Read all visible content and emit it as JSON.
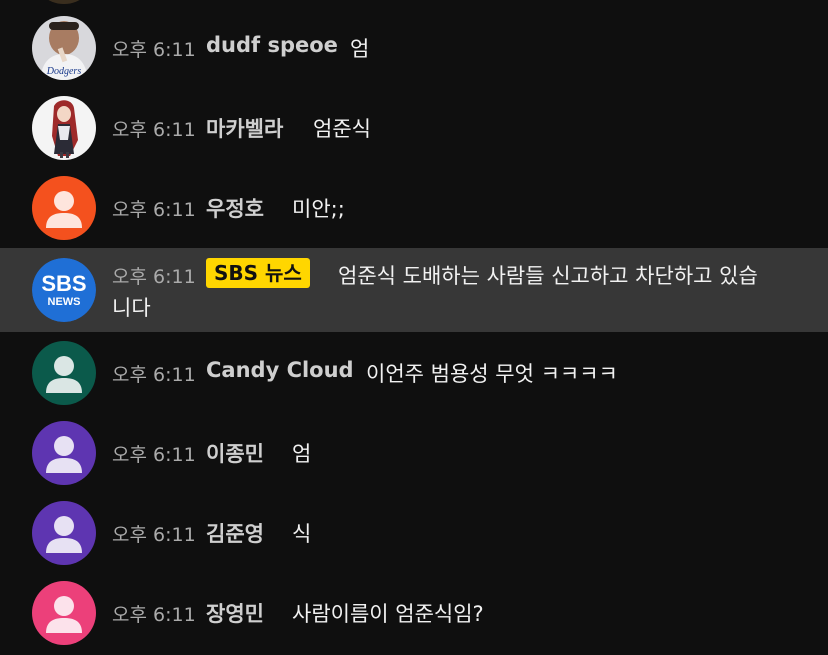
{
  "messages": [
    {
      "time": "오후 6:11",
      "author": "dudf speoe",
      "text": "엄",
      "avatar": {
        "type": "photo",
        "icon": "person-photo-avatar",
        "color": "#d8d8dc"
      }
    },
    {
      "time": "오후 6:11",
      "author": "마카벨라",
      "text": "엄준식",
      "avatar": {
        "type": "anime",
        "icon": "anime-character-avatar",
        "color": "#f4f4f4"
      }
    },
    {
      "time": "오후 6:11",
      "author": "우정호",
      "text": "미안;;",
      "avatar": {
        "type": "default",
        "icon": "default-user-avatar",
        "color": "#f4511e"
      }
    },
    {
      "time": "오후 6:11",
      "author": "SBS 뉴스",
      "text_line1": "엄준식 도배하는 사람들 신고하고 차단하고 있습",
      "text_line2": "니다",
      "avatar": {
        "type": "logo",
        "icon": "sbs-news-logo",
        "logo_line1": "SBS",
        "logo_line2": "NEWS",
        "color": "#1f6fd6"
      },
      "badge_color": "#ffd600"
    },
    {
      "time": "오후 6:11",
      "author": "Candy Cloud",
      "text": "이언주 범용성 무엇 ㅋㅋㅋㅋ",
      "avatar": {
        "type": "default",
        "icon": "default-user-avatar",
        "color": "#0b5a4b"
      }
    },
    {
      "time": "오후 6:11",
      "author": "이종민",
      "text": "엄",
      "avatar": {
        "type": "default",
        "icon": "default-user-avatar",
        "color": "#5e35b1"
      }
    },
    {
      "time": "오후 6:11",
      "author": "김준영",
      "text": "식",
      "avatar": {
        "type": "default",
        "icon": "default-user-avatar",
        "color": "#5e35b1"
      }
    },
    {
      "time": "오후 6:11",
      "author": "장영민",
      "text": "사람이름이 엄준식임?",
      "avatar": {
        "type": "default",
        "icon": "default-user-avatar",
        "color": "#ec407a"
      }
    }
  ]
}
